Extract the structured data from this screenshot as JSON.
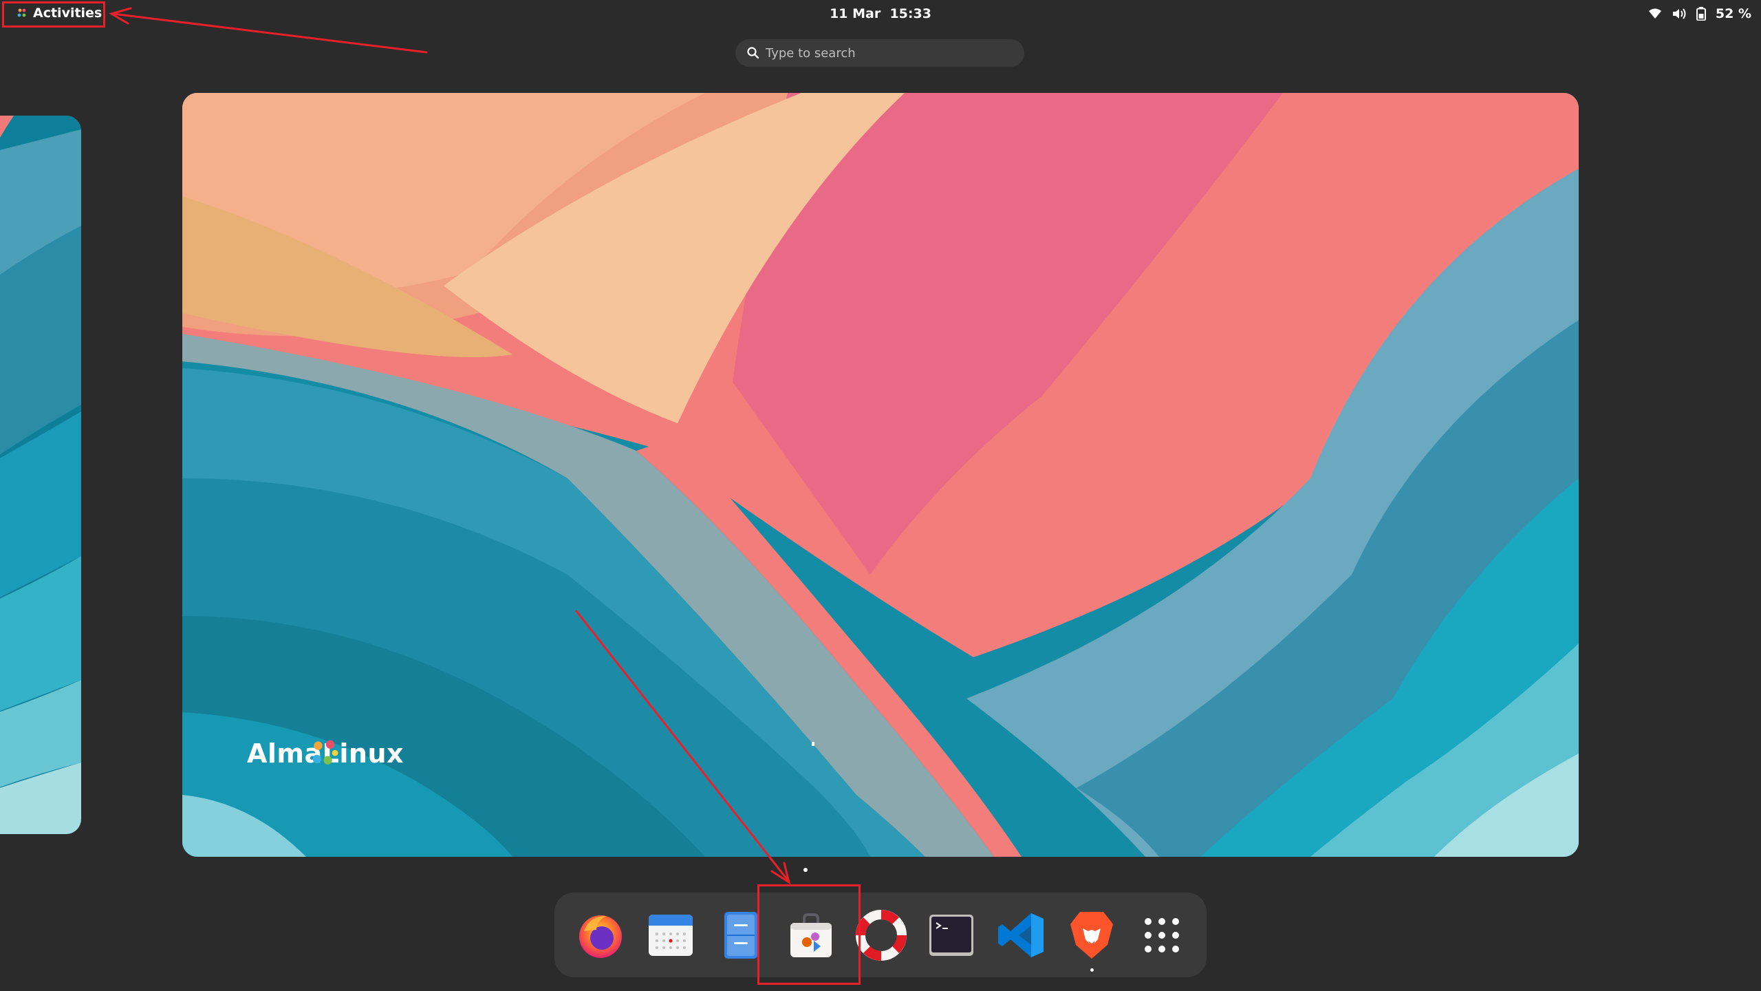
{
  "topbar": {
    "activities_label": "Activities",
    "date": "11 Mar",
    "time": "15:33",
    "battery_percent": "52 %"
  },
  "search": {
    "placeholder": "Type to search"
  },
  "workspace": {
    "brand_text": "AlmaLinux"
  },
  "dash": {
    "items": [
      {
        "name": "Firefox",
        "icon": "firefox-icon",
        "running": false
      },
      {
        "name": "Calendar",
        "icon": "calendar-icon",
        "running": false
      },
      {
        "name": "Files",
        "icon": "file-cabinet-icon",
        "running": false
      },
      {
        "name": "Software",
        "icon": "software-bag-icon",
        "running": false
      },
      {
        "name": "Help",
        "icon": "lifebuoy-icon",
        "running": false
      },
      {
        "name": "Terminal",
        "icon": "terminal-icon",
        "running": false
      },
      {
        "name": "Visual Studio Code",
        "icon": "vscode-icon",
        "running": false
      },
      {
        "name": "Brave",
        "icon": "brave-lion-icon",
        "running": true
      },
      {
        "name": "Show Applications",
        "icon": "app-grid-icon",
        "running": false
      }
    ]
  },
  "colors": {
    "panel": "#2b2b2b",
    "dash": "#3a3a3a",
    "annotation": "#e8202a"
  }
}
